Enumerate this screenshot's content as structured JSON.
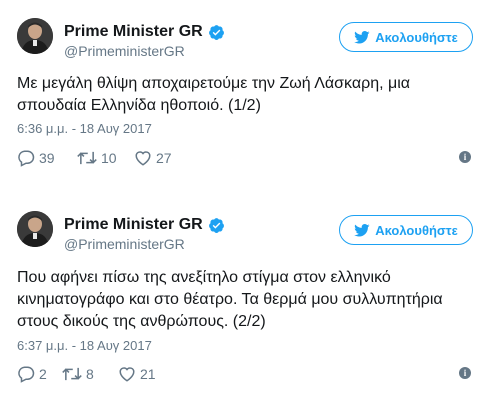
{
  "colors": {
    "accent": "#1da1f2",
    "secondary_text": "#657786",
    "divider": "#e1e8ed"
  },
  "tweets": [
    {
      "name": "Prime Minister GR",
      "handle": "@PrimeministerGR",
      "follow_label": "Ακολουθήστε",
      "text": "Με μεγάλη θλίψη αποχαιρετούμε την Ζωή Λάσκαρη, μια σπουδαία Ελληνίδα ηθοποιό. (1/2)",
      "timestamp": "6:36 μ.μ. - 18 Αυγ 2017",
      "replies": "39",
      "retweets": "10",
      "likes": "27",
      "info_glyph": "i"
    },
    {
      "name": "Prime Minister GR",
      "handle": "@PrimeministerGR",
      "follow_label": "Ακολουθήστε",
      "text": "Που αφήνει πίσω της ανεξίτηλο στίγμα στον ελληνικό κινηματογράφο και στο θέατρο. Τα θερμά μου συλλυπητήρια στους δικούς της ανθρώπους. (2/2)",
      "timestamp": "6:37 μ.μ. - 18 Αυγ 2017",
      "replies": "2",
      "retweets": "8",
      "likes": "21",
      "info_glyph": "i"
    }
  ]
}
